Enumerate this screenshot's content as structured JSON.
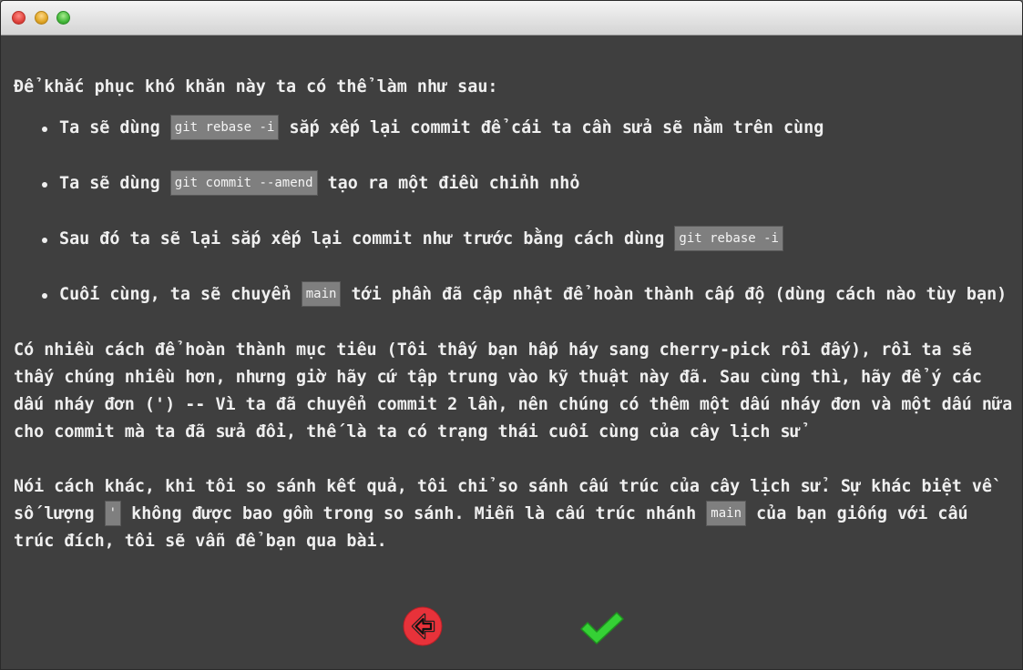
{
  "window": {
    "controls": [
      "close",
      "minimize",
      "zoom"
    ]
  },
  "intro": "Để khắc phục khó khăn này ta có thể làm như sau:",
  "steps": [
    {
      "before": "Ta sẽ dùng ",
      "code": "git rebase -i",
      "after": " sắp xếp lại commit để cái ta cần sửa sẽ nằm trên cùng"
    },
    {
      "before": "Ta sẽ dùng ",
      "code": "git commit --amend",
      "after": " tạo ra một điều chỉnh nhỏ"
    },
    {
      "before": "Sau đó ta sẽ lại sắp xếp lại commit như trước bằng cách dùng ",
      "code": "git rebase -i",
      "after": ""
    },
    {
      "before": "Cuối cùng, ta sẽ chuyển ",
      "code": "main",
      "after": " tới phần đã cập nhật để hoàn thành cấp độ (dùng cách nào tùy bạn)"
    }
  ],
  "paragraph1": {
    "line1": "Có nhiều cách để hoàn thành mục tiêu (Tôi thấy bạn hấp háy sang cherry-pick rồi đấy), rồi ta sẽ",
    "line2": "thấy chúng nhiều hơn, nhưng giờ hãy cứ tập trung vào kỹ thuật này đã. Sau cùng thì, hãy để ý các",
    "line3": "dấu nháy đơn (') -- Vì ta đã chuyển commit 2 lần, nên chúng có thêm một dấu nháy đơn và một dấu nữa",
    "line4": "cho commit mà ta đã sửa đổi, thế là ta có trạng thái cuối cùng của cây lịch sử"
  },
  "paragraph2": {
    "line1": "Nói cách khác, khi tôi so sánh kết quả, tôi chỉ so sánh cấu trúc của cây lịch sử. Sự khác biệt về",
    "line2_before": "số lượng ",
    "line2_code": "'",
    "line2_mid": " không được bao gồm trong so sánh. Miễn là cấu trúc nhánh ",
    "line2_code2": "main",
    "line2_after": " của bạn giống với cấu",
    "line3": "trúc đích, tôi sẽ vẫn để bạn qua bài."
  },
  "nav": {
    "back_icon": "arrow-left-circle-icon",
    "done_icon": "check-icon",
    "colors": {
      "back": "#e8323a",
      "done": "#35d135"
    }
  }
}
